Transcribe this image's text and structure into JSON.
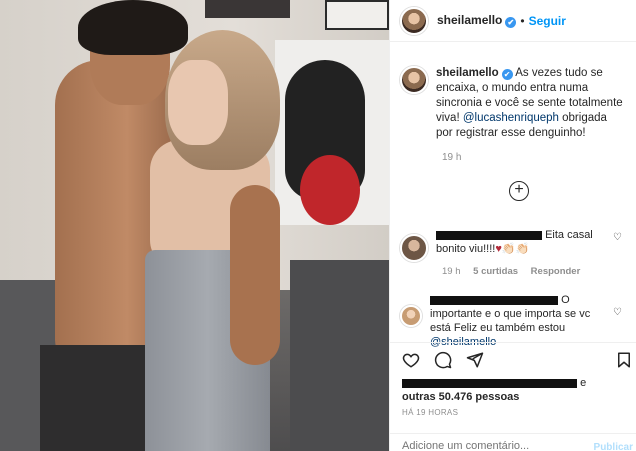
{
  "post": {
    "username": "sheilamello",
    "verified_badge": "✔",
    "separator": "•",
    "follow_label": "Seguir",
    "caption_username": "sheilamello",
    "caption_text_1": "As vezes tudo se encaixa, o mundo entra numa sincronia e você se sente totalmente viva!",
    "caption_mention": "@lucashenriqueph",
    "caption_text_2": "obrigada por registrar esse denguinho!",
    "caption_time": "19 h",
    "load_more_icon": "plus-circle-icon"
  },
  "comments": [
    {
      "text_1": "Eita casal bonito",
      "text_2": "viu!!!!",
      "emojis": "♥👏🏻👏🏻",
      "time": "19 h",
      "likes": "5 curtidas",
      "reply": "Responder"
    },
    {
      "text_1": "O importante",
      "text_2": "e o que importa se vc está Feliz eu também estou",
      "mention": "@sheilamello"
    }
  ],
  "likes_suffix": "e",
  "likes_text": "outras 50.476 pessoas",
  "time_ago": "HÁ 19 HORAS",
  "add_comment_placeholder": "Adicione um comentário...",
  "publish_label": "Publicar",
  "colors": {
    "accent": "#0095f6",
    "mention": "#00376b",
    "muted": "#8e8e8e"
  }
}
